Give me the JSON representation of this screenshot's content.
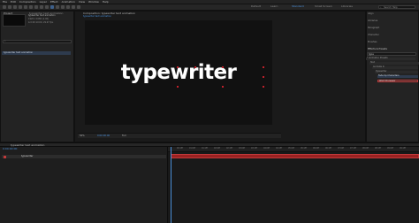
{
  "menu": [
    "File",
    "Edit",
    "Composition",
    "Layer",
    "Effect",
    "Animation",
    "View",
    "Window",
    "Help"
  ],
  "workspaces": [
    "Default",
    "Learn",
    "Standard",
    "Small Screen",
    "Libraries"
  ],
  "workspace_active": "Standard",
  "project": {
    "tab": "Project",
    "comp_name": "typewriter text animation",
    "info_lines": [
      "1920 x 1080 (1.00)",
      "Δ 0:00:10:00, 29.97 fps"
    ],
    "item_name": "typewriter text animation"
  },
  "composition": {
    "tab": "Composition: typewriter text animation",
    "breadcrumb": "typewriter text animation",
    "text": "typewriter",
    "zoom": "50%",
    "resolution": "Full",
    "timecode": "0:00:00:00"
  },
  "right_panel": {
    "items": [
      "Align",
      "Libraries",
      "Paragraph",
      "Character",
      "Brushes"
    ],
    "effects_title": "Effects & Presets",
    "search_value": "type",
    "search_panel": "Search Help",
    "tree": [
      "* Animation Presets",
      "Text",
      "Animate In",
      "Typewriter",
      "Fade Up Characters",
      "Word Processor"
    ]
  },
  "timeline": {
    "tab": "typewriter text animation",
    "timecode": "0:00:00:00",
    "layer": "typewriter",
    "ticks": [
      "00:15f",
      "01:00f",
      "01:15f",
      "02:00f",
      "02:15f",
      "03:00f",
      "03:15f",
      "04:00f",
      "04:15f",
      "05:00f",
      "05:15f",
      "06:00f",
      "06:15f",
      "07:00f",
      "07:15f",
      "08:00f",
      "08:15f",
      "09:00f",
      "09:15f"
    ]
  }
}
